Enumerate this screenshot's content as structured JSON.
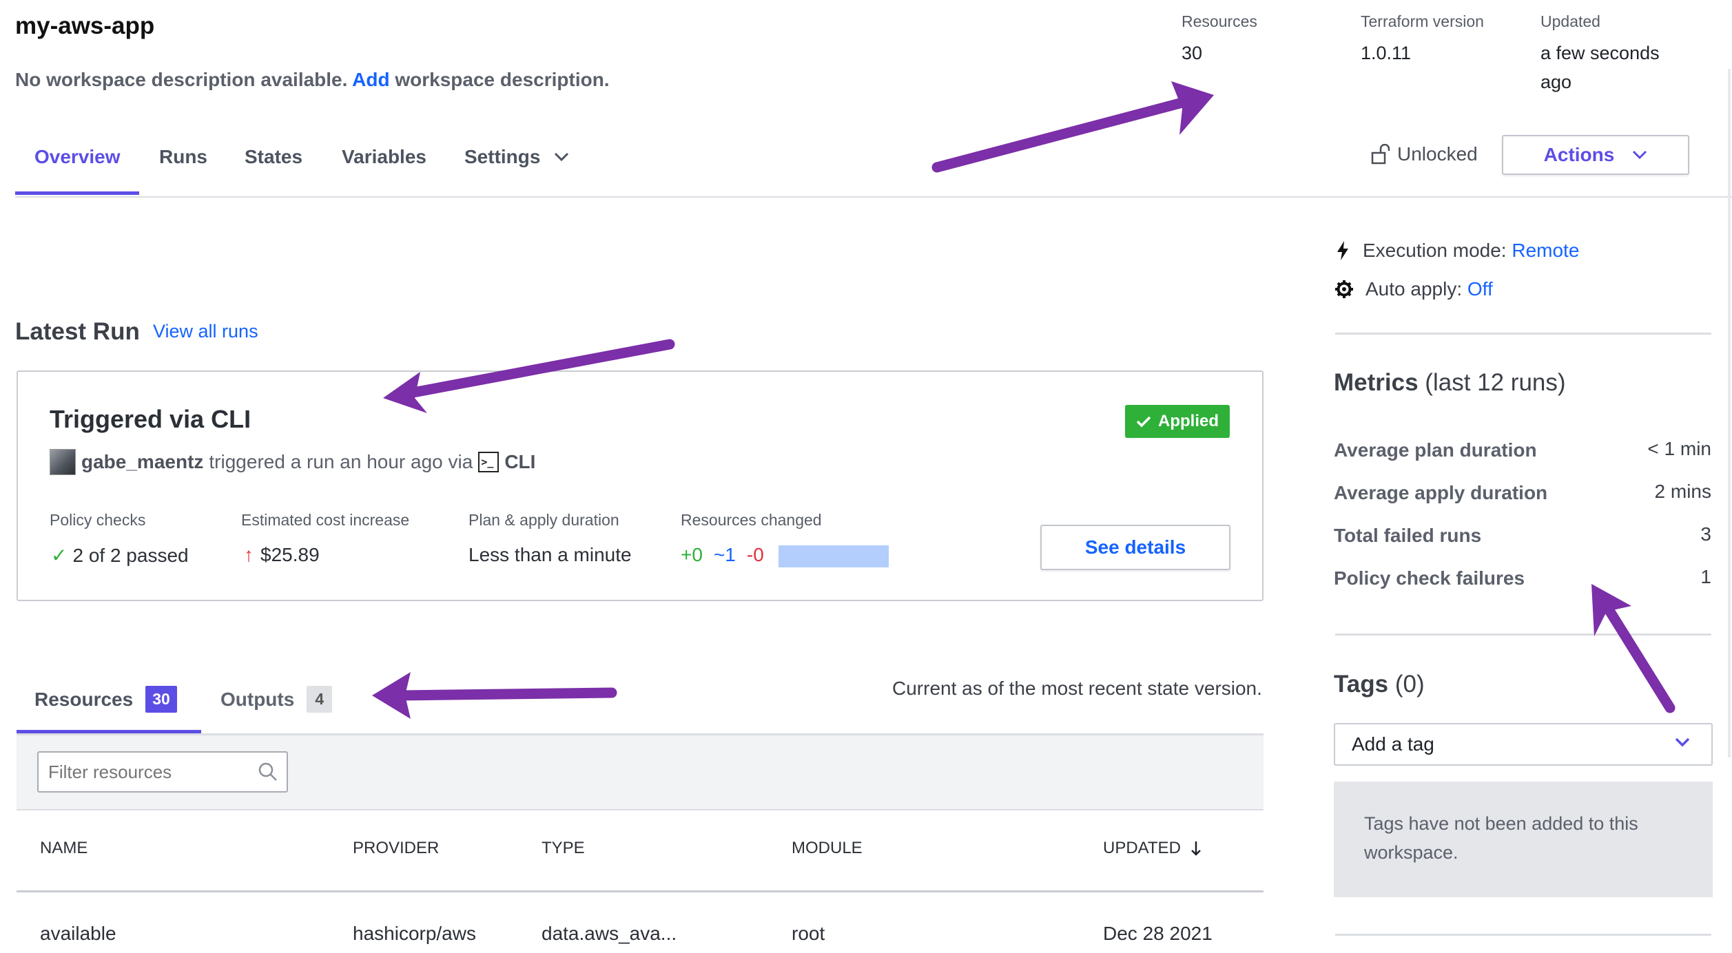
{
  "workspace": {
    "title": "my-aws-app",
    "desc_prefix": "No workspace description available.",
    "desc_link": "Add",
    "desc_suffix": "workspace description."
  },
  "header_meta": {
    "resources_label": "Resources",
    "resources_value": "30",
    "tf_label": "Terraform version",
    "tf_value": "1.0.11",
    "updated_label": "Updated",
    "updated_value_1": "a few seconds",
    "updated_value_2": "ago"
  },
  "nav": {
    "tabs": [
      {
        "label": "Overview",
        "active": true
      },
      {
        "label": "Runs"
      },
      {
        "label": "States"
      },
      {
        "label": "Variables"
      },
      {
        "label": "Settings"
      }
    ],
    "unlocked": "Unlocked",
    "actions": "Actions"
  },
  "latest_run": {
    "title": "Latest Run",
    "view_all": "View all runs",
    "card_title": "Triggered via CLI",
    "status": "Applied",
    "user": "gabe_maentz",
    "action_text": "triggered a run an hour ago via",
    "via": "CLI",
    "stats": {
      "policy_label": "Policy checks",
      "policy_value": "2 of 2 passed",
      "cost_label": "Estimated cost increase",
      "cost_value": "$25.89",
      "duration_label": "Plan & apply duration",
      "duration_value": "Less than a minute",
      "changed_label": "Resources changed",
      "added": "+0",
      "changed": "~1",
      "destroyed": "-0"
    },
    "see_details": "See details"
  },
  "resources": {
    "tab_label": "Resources",
    "tab_count": "30",
    "outputs_label": "Outputs",
    "outputs_count": "4",
    "note": "Current as of the most recent state version.",
    "filter_placeholder": "Filter resources",
    "columns": [
      "NAME",
      "PROVIDER",
      "TYPE",
      "MODULE",
      "UPDATED"
    ],
    "rows": [
      [
        "available",
        "hashicorp/aws",
        "data.aws_ava...",
        "root",
        "Dec 28 2021"
      ]
    ]
  },
  "sidebar": {
    "execution_label": "Execution mode:",
    "execution_value": "Remote",
    "autoapply_label": "Auto apply:",
    "autoapply_value": "Off",
    "metrics_title": "Metrics",
    "metrics_sub": "(last 12 runs)",
    "metrics": [
      {
        "label": "Average plan duration",
        "value": "< 1 min"
      },
      {
        "label": "Average apply duration",
        "value": "2 mins"
      },
      {
        "label": "Total failed runs",
        "value": "3"
      },
      {
        "label": "Policy check failures",
        "value": "1"
      }
    ],
    "tags_title": "Tags",
    "tags_count": "(0)",
    "tag_placeholder": "Add a tag",
    "tags_empty": "Tags have not been added to this workspace."
  },
  "colors": {
    "accent": "#5c4ee5",
    "link": "#1563ff",
    "success": "#2eb039",
    "danger": "#e0303c",
    "annotation_arrow": "#7b2fa8"
  }
}
